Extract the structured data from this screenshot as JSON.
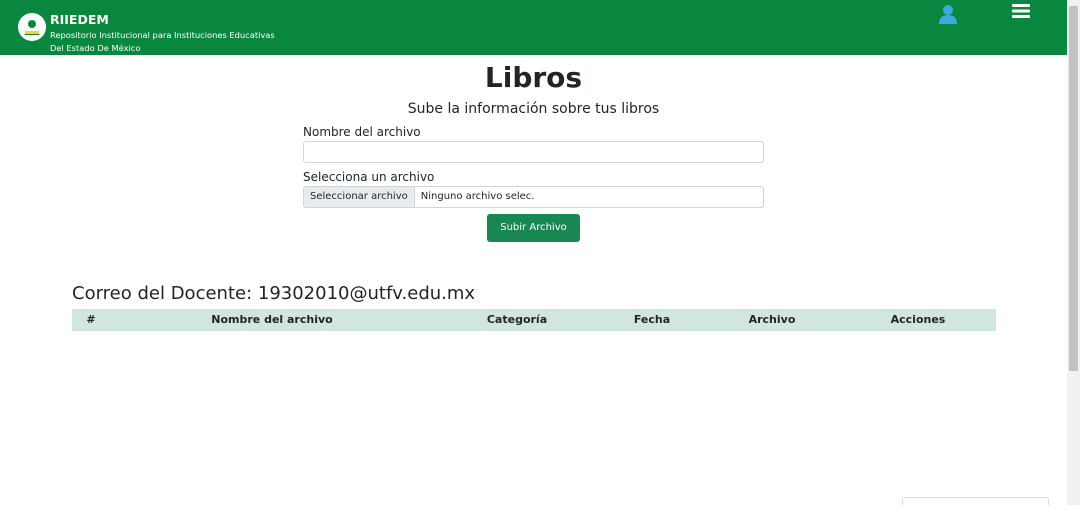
{
  "header": {
    "brand_title": "RIIEDEM",
    "brand_subtitle": "Repositorio Institucional para Instituciones Educativas Del Estado De México",
    "logo_icon": "education-logo-icon",
    "user_icon": "user-icon",
    "menu_icon": "hamburger-menu-icon",
    "bar_color": "#0a873e"
  },
  "main": {
    "title": "Libros",
    "subtitle": "Sube la información sobre tus libros",
    "filename_label": "Nombre del archivo",
    "filename_value": "",
    "file_label": "Selecciona un archivo",
    "file_button_label": "Seleccionar archivo",
    "file_chosen_text": "Ninguno archivo selec.",
    "submit_label": "Subir Archivo",
    "submit_color": "#198754"
  },
  "teacher": {
    "email_heading": "Correo del Docente: 19302010@utfv.edu.mx"
  },
  "table": {
    "columns": [
      "#",
      "Nombre del archivo",
      "Categoría",
      "Fecha",
      "Archivo",
      "Acciones"
    ],
    "rows": [],
    "header_color": "#d1e7dd"
  }
}
